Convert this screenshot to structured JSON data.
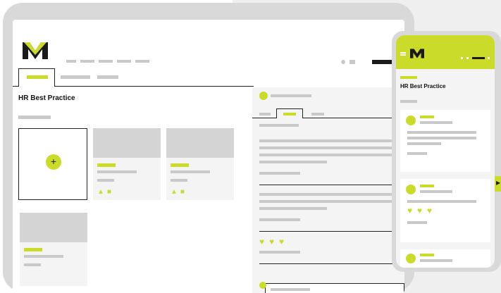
{
  "page": {
    "title": "HR Best Practice"
  },
  "mobile": {
    "title": "HR Best Practice"
  },
  "icons": {
    "logo": "m-logo",
    "add": "plus-icon",
    "like": "thumbs-up-icon",
    "comment": "comment-icon",
    "heart": "heart-icon",
    "menu": "hamburger-icon",
    "expand": "chevron-right-icon"
  },
  "colors": {
    "accent": "#cadb2a",
    "placeholder": "#c9c9c9",
    "ink": "#1a1a1a"
  },
  "glyphs": {
    "plus": "+",
    "heart": "♥",
    "like": "▲",
    "comment": "■",
    "expand": "▶"
  }
}
